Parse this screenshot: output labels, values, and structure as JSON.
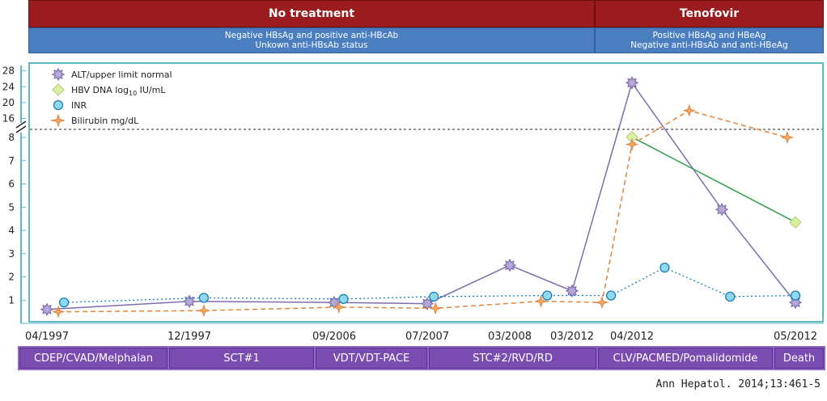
{
  "headers": {
    "left_title": "No treatment",
    "right_title": "Tenofovir",
    "left_line1": "Negative HBsAg and positive anti-HBcAb",
    "left_line2": "Unkown anti-HBsAb status",
    "right_line1": "Positive HBsAg and HBeAg",
    "right_line2": "Negative anti-HBsAb and anti-HBeAg"
  },
  "treatments": [
    "CDEP/CVAD/Melphalan",
    "SCT#1",
    "VDT/VDT-PACE",
    "STC#2/RVD/RD",
    "CLV/PACMED/Pomalidomide",
    "Death"
  ],
  "citation": "Ann Hepatol. 2014;13:461-5",
  "colors": {
    "alt": "#7e6cae",
    "alt_fill": "#b6a9d8",
    "hbv": "#2e9e4a",
    "hbv_fill": "#d8f0a0",
    "inr": "#1a7fb8",
    "inr_fill": "#8fd8ee",
    "bili": "#e0843a",
    "frame": "#5fb8c8"
  },
  "chart_data": {
    "type": "line",
    "x_tick_labels": [
      "04/1997",
      "12/1997",
      "09/2006",
      "07/2007",
      "03/2008",
      "03/2012",
      "04/2012",
      "05/2012"
    ],
    "y_tick_labels_lower": [
      "1",
      "2",
      "3",
      "4",
      "5",
      "6",
      "7",
      "8"
    ],
    "y_tick_labels_upper": [
      "16",
      "20",
      "24",
      "28"
    ],
    "y_axis_break": "between 8 and 16 (dashed reference line)",
    "legend": {
      "alt": "ALT/upper limit normal",
      "hbv_prefix": "HBV DNA log",
      "hbv_sub": "10",
      "hbv_suffix": " IU/mL",
      "inr": "INR",
      "bili": "Bilirubin mg/dL"
    },
    "series": [
      {
        "key": "alt",
        "name": "ALT/upper limit normal",
        "points": [
          [
            0,
            0.6
          ],
          [
            1,
            0.95
          ],
          [
            2,
            0.9
          ],
          [
            3,
            0.85
          ],
          [
            4,
            2.5
          ],
          [
            5,
            1.4
          ],
          [
            6,
            25
          ],
          [
            6.55,
            4.9
          ],
          [
            7,
            0.9
          ]
        ]
      },
      {
        "key": "hbv",
        "name": "HBV DNA log10 IU/mL",
        "points": [
          [
            6,
            8.3
          ],
          [
            7,
            4.35
          ]
        ]
      },
      {
        "key": "inr",
        "name": "INR",
        "points": [
          [
            0.12,
            0.9
          ],
          [
            1.1,
            1.1
          ],
          [
            2.1,
            1.05
          ],
          [
            3.08,
            1.15
          ],
          [
            4.6,
            1.2
          ],
          [
            5.65,
            1.2
          ],
          [
            6.2,
            2.4
          ],
          [
            6.6,
            1.15
          ],
          [
            7.12,
            1.2
          ]
        ]
      },
      {
        "key": "bili",
        "name": "Bilirubin mg/dL",
        "points": [
          [
            0.08,
            0.5
          ],
          [
            1.1,
            0.55
          ],
          [
            2.05,
            0.7
          ],
          [
            3.1,
            0.65
          ],
          [
            4.5,
            0.95
          ],
          [
            5.5,
            0.9
          ],
          [
            6,
            7.7
          ],
          [
            6.35,
            18
          ],
          [
            6.95,
            8.0
          ]
        ]
      }
    ]
  }
}
